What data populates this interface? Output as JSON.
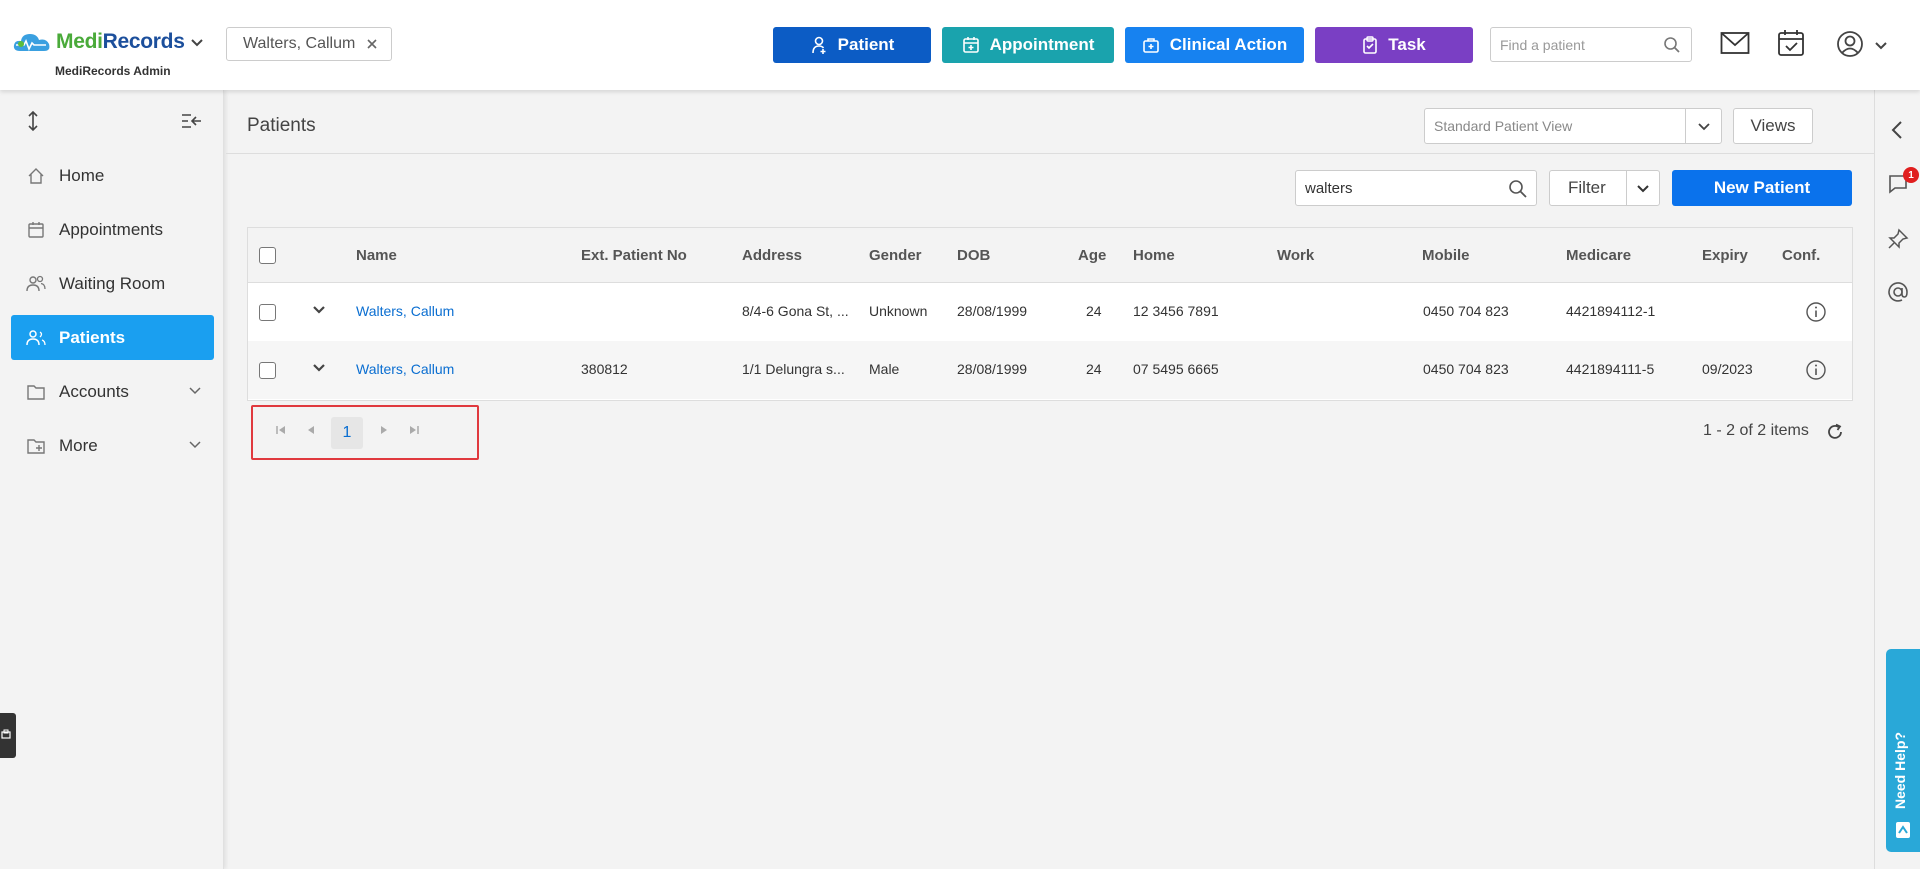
{
  "app": {
    "logo_medi": "Medi",
    "logo_records": "Records",
    "subtitle": "MediRecords Admin",
    "brand_green": "#4aaa3a",
    "brand_blue": "#1c4f9c"
  },
  "header": {
    "open_patient": "Walters, Callum",
    "buttons": {
      "patient": "Patient",
      "appointment": "Appointment",
      "clinical_action": "Clinical Action",
      "task": "Task"
    },
    "find_placeholder": "Find a patient"
  },
  "sidebar": {
    "items": [
      {
        "label": "Home",
        "icon": "home-icon"
      },
      {
        "label": "Appointments",
        "icon": "calendar-icon"
      },
      {
        "label": "Waiting Room",
        "icon": "people-icon"
      },
      {
        "label": "Patients",
        "icon": "person-icon",
        "active": true
      },
      {
        "label": "Accounts",
        "icon": "folder-icon"
      },
      {
        "label": "More",
        "icon": "folder-plus-icon"
      }
    ]
  },
  "main": {
    "title": "Patients",
    "view_placeholder": "Standard Patient View",
    "views_label": "Views",
    "search_value": "walters",
    "filter_label": "Filter",
    "new_patient_label": "New Patient",
    "columns": [
      "Name",
      "Ext. Patient No",
      "Address",
      "Gender",
      "DOB",
      "Age",
      "Home",
      "Work",
      "Mobile",
      "Medicare",
      "Expiry",
      "Conf."
    ],
    "rows": [
      {
        "name": "Walters, Callum",
        "ext": "",
        "address": "8/4-6 Gona St, ...",
        "gender": "Unknown",
        "dob": "28/08/1999",
        "age": "24",
        "home": "12 3456 7891",
        "work": "",
        "mobile": "0450 704 823",
        "medicare": "4421894112-1",
        "expiry": ""
      },
      {
        "name": "Walters, Callum",
        "ext": "380812",
        "address": "1/1 Delungra s...",
        "gender": "Male",
        "dob": "28/08/1999",
        "age": "24",
        "home": "07 5495 6665",
        "work": "",
        "mobile": "0450 704 823",
        "medicare": "4421894111-5",
        "expiry": "09/2023"
      }
    ],
    "pager": {
      "current_page": "1",
      "summary": "1 - 2 of 2 items"
    }
  },
  "rail": {
    "notification_count": "1",
    "help_label": "Need Help?"
  }
}
